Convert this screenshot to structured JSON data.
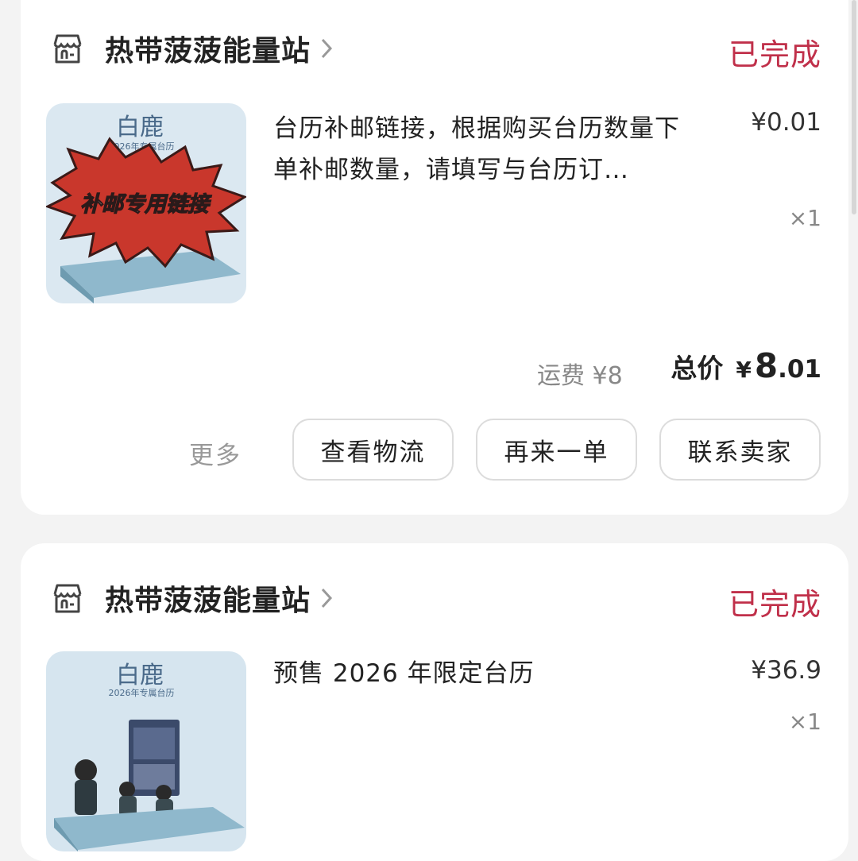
{
  "orders": [
    {
      "shop_name": "热带菠菠能量站",
      "status": "已完成",
      "thumb_brand": "白鹿",
      "thumb_subtitle": "2026年专属台历",
      "thumb_banner": "补邮专用链接",
      "product_title": "台历补邮链接，根据购买台历数量下单补邮数量，请填写与台历订…",
      "price": "¥0.01",
      "quantity": "×1",
      "shipping": "运费 ¥8",
      "total_label": "总价",
      "total_symbol": "¥",
      "total_integer": "8",
      "total_decimal": ".01",
      "more_label": "更多",
      "buttons": [
        "查看物流",
        "再来一单",
        "联系卖家"
      ]
    },
    {
      "shop_name": "热带菠菠能量站",
      "status": "已完成",
      "thumb_brand": "白鹿",
      "thumb_subtitle": "2026年专属台历",
      "product_title": "预售 2026 年限定台历",
      "price": "¥36.9",
      "quantity": "×1"
    }
  ],
  "colors": {
    "status": "#c0304a",
    "background": "#f3f3f3",
    "card": "#ffffff"
  },
  "icons": {
    "shop": "storefront-icon",
    "chevron": "chevron-right-icon"
  }
}
